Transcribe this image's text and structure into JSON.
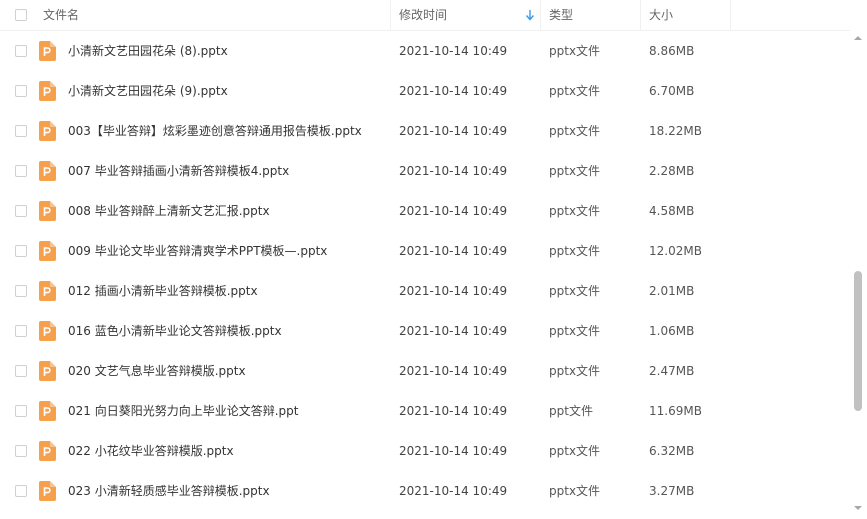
{
  "header": {
    "name": "文件名",
    "modified": "修改时间",
    "type": "类型",
    "size": "大小"
  },
  "colors": {
    "file_icon": "#f5a04d",
    "sort_arrow": "#3b9be6"
  },
  "icons": {
    "file": "presentation-file-icon",
    "sort": "sort-down-arrow-icon"
  },
  "rows": [
    {
      "name": "小清新文艺田园花朵 (8).pptx",
      "date": "2021-10-14 10:49",
      "type": "pptx文件",
      "size": "8.86MB"
    },
    {
      "name": "小清新文艺田园花朵 (9).pptx",
      "date": "2021-10-14 10:49",
      "type": "pptx文件",
      "size": "6.70MB"
    },
    {
      "name": "003【毕业答辩】炫彩墨迹创意答辩通用报告模板.pptx",
      "date": "2021-10-14 10:49",
      "type": "pptx文件",
      "size": "18.22MB"
    },
    {
      "name": "007 毕业答辩插画小清新答辩模板4.pptx",
      "date": "2021-10-14 10:49",
      "type": "pptx文件",
      "size": "2.28MB"
    },
    {
      "name": "008 毕业答辩醉上清新文艺汇报.pptx",
      "date": "2021-10-14 10:49",
      "type": "pptx文件",
      "size": "4.58MB"
    },
    {
      "name": "009 毕业论文毕业答辩清爽学术PPT模板—.pptx",
      "date": "2021-10-14 10:49",
      "type": "pptx文件",
      "size": "12.02MB"
    },
    {
      "name": "012 插画小清新毕业答辩模板.pptx",
      "date": "2021-10-14 10:49",
      "type": "pptx文件",
      "size": "2.01MB"
    },
    {
      "name": "016 蓝色小清新毕业论文答辩模板.pptx",
      "date": "2021-10-14 10:49",
      "type": "pptx文件",
      "size": "1.06MB"
    },
    {
      "name": "020 文艺气息毕业答辩模版.pptx",
      "date": "2021-10-14 10:49",
      "type": "pptx文件",
      "size": "2.47MB"
    },
    {
      "name": "021 向日葵阳光努力向上毕业论文答辩.ppt",
      "date": "2021-10-14 10:49",
      "type": "ppt文件",
      "size": "11.69MB"
    },
    {
      "name": "022 小花纹毕业答辩模版.pptx",
      "date": "2021-10-14 10:49",
      "type": "pptx文件",
      "size": "6.32MB"
    },
    {
      "name": "023 小清新轻质感毕业答辩模板.pptx",
      "date": "2021-10-14 10:49",
      "type": "pptx文件",
      "size": "3.27MB"
    }
  ]
}
